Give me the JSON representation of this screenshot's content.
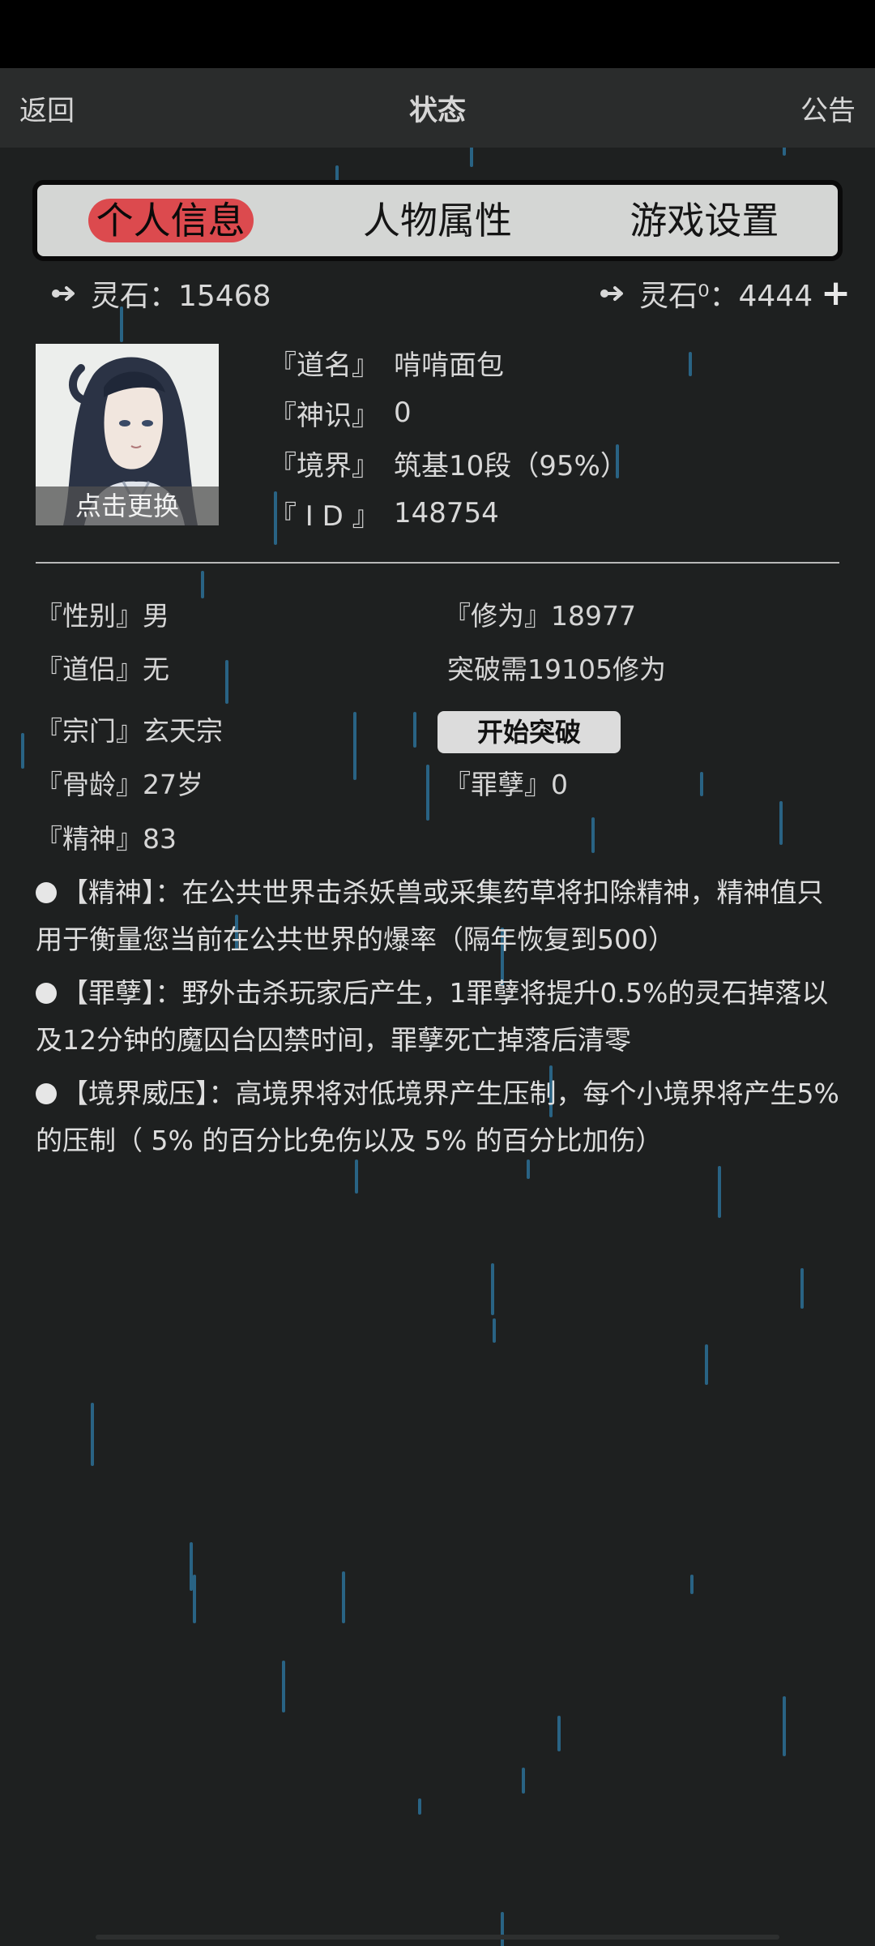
{
  "header": {
    "back_label": "返回",
    "title": "状态",
    "notice_label": "公告"
  },
  "tabs": [
    {
      "label": "个人信息",
      "active": true
    },
    {
      "label": "人物属性",
      "active": false
    },
    {
      "label": "游戏设置",
      "active": false
    }
  ],
  "currency": {
    "left": {
      "label": "灵石：15468"
    },
    "right": {
      "label": "灵石⁰：4444"
    },
    "add_symbol": "+"
  },
  "avatar": {
    "change_label": "点击更换"
  },
  "profile": [
    {
      "key": "『道名』",
      "value": "啃啃面包"
    },
    {
      "key": "『神识』",
      "value": "0"
    },
    {
      "key": "『境界』",
      "value": "筑基10段（95%）"
    },
    {
      "key": "『 I D 』",
      "value": "148754"
    }
  ],
  "stats": {
    "gender": "『性别』男",
    "partner": "『道侣』无",
    "sect": "『宗门』玄天宗",
    "bone_age": "『骨龄』27岁",
    "spirit": "『精神』83",
    "cultivation": "『修为』18977",
    "break_need": "突破需19105修为",
    "break_button": "开始突破",
    "sin": "『罪孽』0"
  },
  "notes": [
    "【精神】：在公共世界击杀妖兽或采集药草将扣除精神，精神值只用于衡量您当前在公共世界的爆率（隔年恢复到500）",
    "【罪孽】：野外击杀玩家后产生，1罪孽将提升0.5%的灵石掉落以及12分钟的魔囚台囚禁时间，罪孽死亡掉落后清零",
    "【境界威压】：高境界将对低境界产生压制，每个小境界将产生5% 的压制（ 5% 的百分比免伤以及 5% 的百分比加伤）"
  ],
  "colors": {
    "active_tab": "#dc4a4e",
    "background": "#1e2020",
    "rain": "#2b6f96"
  },
  "icons": {
    "currency": "spirit-stone-icon",
    "add": "plus-icon"
  }
}
